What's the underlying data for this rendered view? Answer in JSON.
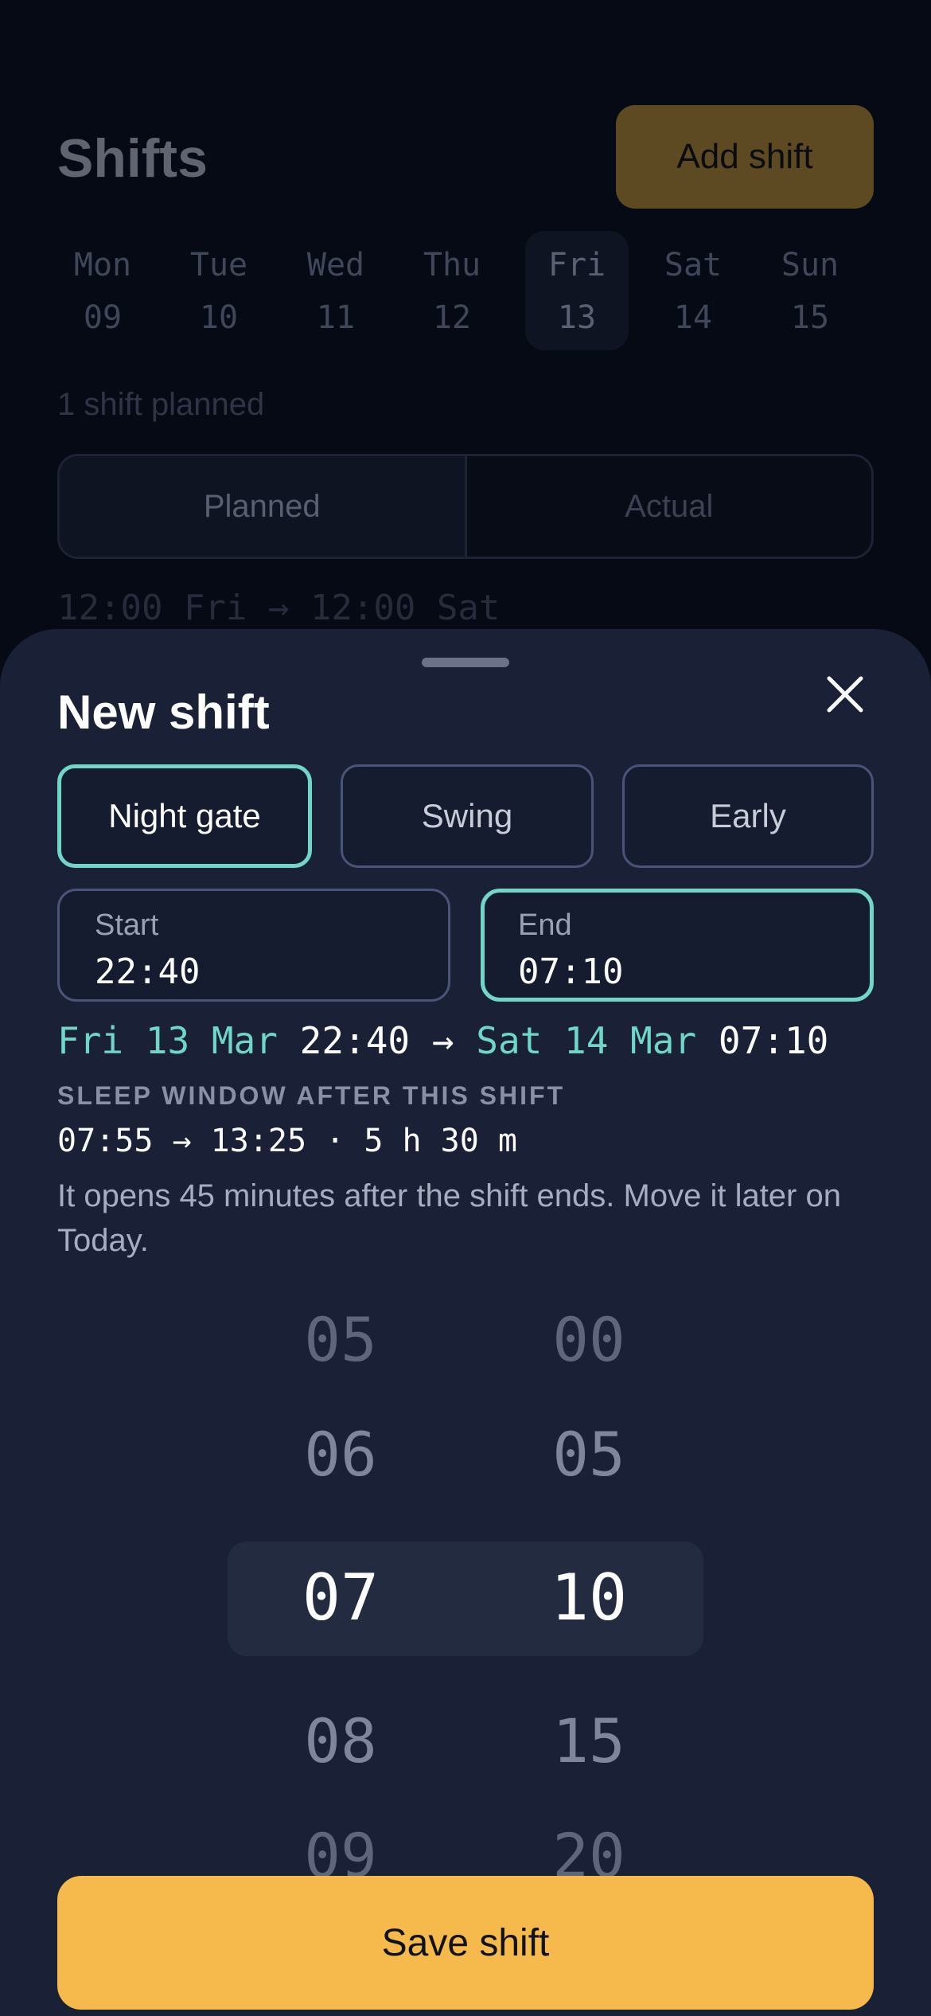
{
  "background": {
    "title": "Shifts",
    "add_label": "Add shift",
    "week": [
      {
        "name": "Mon",
        "date": "09"
      },
      {
        "name": "Tue",
        "date": "10"
      },
      {
        "name": "Wed",
        "date": "11"
      },
      {
        "name": "Thu",
        "date": "12"
      },
      {
        "name": "Fri",
        "date": "13"
      },
      {
        "name": "Sat",
        "date": "14"
      },
      {
        "name": "Sun",
        "date": "15"
      }
    ],
    "selected_day": "Fri",
    "count_text": "1 shift planned",
    "tabs": [
      "Planned",
      "Actual"
    ],
    "active_tab": "Planned",
    "shift_line": "12:00 Fri → 12:00 Sat"
  },
  "sheet": {
    "title": "New shift",
    "close_icon": "close-icon",
    "presets": [
      "Night gate",
      "Swing",
      "Early"
    ],
    "active_preset": "Night gate",
    "start": {
      "label": "Start",
      "value": "22:40"
    },
    "end": {
      "label": "End",
      "value": "07:10"
    },
    "active_field": "End",
    "range": {
      "start_date": "Fri 13 Mar",
      "start_time": "22:40",
      "arrow": "→",
      "end_date": "Sat 14 Mar",
      "end_time": "07:10"
    },
    "sleep_label": "SLEEP WINDOW AFTER THIS SHIFT",
    "sleep_value": "07:55 → 13:25 · 5 h 30 m",
    "sleep_note": "It opens 45 minutes after the shift ends. Move it later on Today.",
    "picker": {
      "hours": [
        "05",
        "06",
        "07",
        "08",
        "09"
      ],
      "minutes": [
        "00",
        "05",
        "10",
        "15",
        "20"
      ],
      "selected_hour": "07",
      "selected_minute": "10"
    },
    "save_label": "Save shift",
    "colors": {
      "accent": "#6fd6c8",
      "primary": "#f5b94c",
      "sheet_bg": "#1a2035"
    }
  }
}
